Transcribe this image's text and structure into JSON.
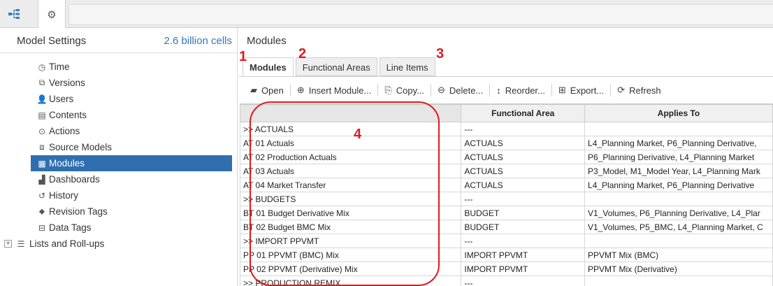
{
  "topbar": {
    "tab1_icon": "model-hierarchy-icon",
    "tab2_icon": "gear-icon"
  },
  "sidebar": {
    "title": "Model Settings",
    "cell_count": "2.6 billion cells",
    "items": [
      {
        "label": "Time",
        "icon": "clock-icon",
        "glyph": "◷"
      },
      {
        "label": "Versions",
        "icon": "versions-icon",
        "glyph": "⧉"
      },
      {
        "label": "Users",
        "icon": "user-icon",
        "glyph": "👤"
      },
      {
        "label": "Contents",
        "icon": "contents-icon",
        "glyph": "▤"
      },
      {
        "label": "Actions",
        "icon": "play-circle-icon",
        "glyph": "⊙"
      },
      {
        "label": "Source Models",
        "icon": "source-models-icon",
        "glyph": "⧈"
      },
      {
        "label": "Modules",
        "icon": "grid-icon",
        "glyph": "▦"
      },
      {
        "label": "Dashboards",
        "icon": "dashboard-icon",
        "glyph": "▟"
      },
      {
        "label": "History",
        "icon": "history-icon",
        "glyph": "↺"
      },
      {
        "label": "Revision Tags",
        "icon": "tag-icon",
        "glyph": "⬥"
      },
      {
        "label": "Data Tags",
        "icon": "data-tag-icon",
        "glyph": "⊟"
      },
      {
        "label": "Lists and Roll-ups",
        "icon": "list-icon",
        "glyph": "☰",
        "expand": "+"
      }
    ],
    "selected": "Modules"
  },
  "main": {
    "title": "Modules",
    "tabs": [
      "Modules",
      "Functional Areas",
      "Line Items"
    ],
    "active_tab": "Modules",
    "toolbar": [
      {
        "label": "Open",
        "icon": "folder-open-icon",
        "glyph": "▰"
      },
      {
        "label": "Insert Module...",
        "icon": "plus-circle-icon",
        "glyph": "⊕"
      },
      {
        "label": "Copy...",
        "icon": "copy-icon",
        "glyph": "⎘"
      },
      {
        "label": "Delete...",
        "icon": "minus-circle-icon",
        "glyph": "⊖"
      },
      {
        "label": "Reorder...",
        "icon": "reorder-icon",
        "glyph": "↕"
      },
      {
        "label": "Export...",
        "icon": "export-icon",
        "glyph": "⊞"
      },
      {
        "label": "Refresh",
        "icon": "refresh-icon",
        "glyph": "⟳"
      }
    ],
    "grid": {
      "columns": [
        "",
        "Functional Area",
        "Applies To"
      ],
      "rows": [
        [
          ">> ACTUALS",
          "---",
          ""
        ],
        [
          "AT 01 Actuals",
          "ACTUALS",
          "L4_Planning Market, P6_Planning Derivative,"
        ],
        [
          "AT 02 Production Actuals",
          "ACTUALS",
          "P6_Planning Derivative, L4_Planning Market"
        ],
        [
          "AT 03 Actuals",
          "ACTUALS",
          "P3_Model, M1_Model Year, L4_Planning Mark"
        ],
        [
          "AT 04 Market Transfer",
          "ACTUALS",
          "L4_Planning Market, P6_Planning Derivative"
        ],
        [
          ">> BUDGETS",
          "---",
          ""
        ],
        [
          "BT 01 Budget Derivative Mix",
          "BUDGET",
          "V1_Volumes, P6_Planning Derivative, L4_Plar"
        ],
        [
          "BT 02 Budget BMC Mix",
          "BUDGET",
          "V1_Volumes, P5_BMC, L4_Planning Market, C"
        ],
        [
          ">> IMPORT PPVMT",
          "---",
          ""
        ],
        [
          "PP 01 PPVMT (BMC) Mix",
          "IMPORT PPVMT",
          "PPVMT Mix (BMC)"
        ],
        [
          "PP 02 PPVMT (Derivative) Mix",
          "IMPORT PPVMT",
          "PPVMT Mix (Derivative)"
        ],
        [
          ">> PRODUCTION REMIX",
          "---",
          ""
        ]
      ]
    }
  },
  "annotations": {
    "n1": "1",
    "n2": "2",
    "n3": "3",
    "n4": "4",
    "color": "#e0191f"
  }
}
